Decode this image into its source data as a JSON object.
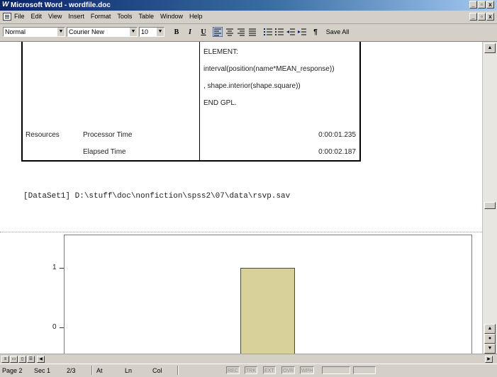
{
  "window": {
    "title": "Microsoft Word - wordfile.doc",
    "app_icon": "word-w-icon"
  },
  "menu": {
    "items": [
      "File",
      "Edit",
      "View",
      "Insert",
      "Format",
      "Tools",
      "Table",
      "Window",
      "Help"
    ]
  },
  "toolbar": {
    "style": "Normal",
    "font": "Courier New",
    "size": "10",
    "bold": "B",
    "italic": "I",
    "underline": "U",
    "pilcrow": "¶",
    "save_all": "Save All"
  },
  "document": {
    "gpl_lines": [
      "ELEMENT:",
      "interval(position(name*MEAN_response))",
      ", shape.interior(shape.square))",
      "END GPL."
    ],
    "resources_label": "Resources",
    "processor_time_label": "Processor Time",
    "processor_time_value": "0:00:01.235",
    "elapsed_time_label": "Elapsed Time",
    "elapsed_time_value": "0:00:02.187",
    "dataset_line": "[DataSet1] D:\\stuff\\doc\\nonfiction\\spss2\\07\\data\\rsvp.sav",
    "chart_data": {
      "type": "bar",
      "categories": [
        ""
      ],
      "values": [
        1
      ],
      "yticks": [
        "1",
        "0"
      ],
      "colors": {
        "bar": "#d8d19a"
      }
    }
  },
  "statusbar": {
    "page": "Page 2",
    "sec": "Sec 1",
    "pages": "2/3",
    "at": "At",
    "ln": "Ln",
    "col": "Col",
    "rec": "REC",
    "trk": "TRK",
    "ext": "EXT",
    "ovr": "OVR",
    "wph": "WPH"
  }
}
